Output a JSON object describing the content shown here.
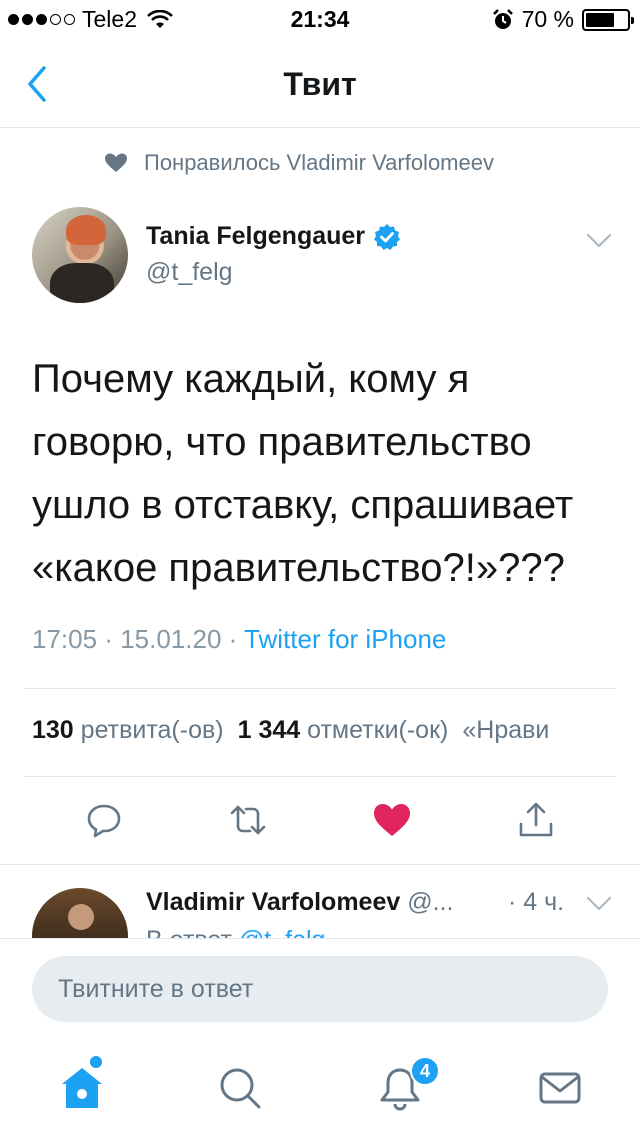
{
  "status_bar": {
    "carrier": "Tele2",
    "time": "21:34",
    "battery_text": "70 %",
    "battery_level": 0.7,
    "signal_bars_filled": 3,
    "signal_bars_total": 5
  },
  "nav": {
    "title": "Твит"
  },
  "tweet": {
    "liked_by": "Понравилось Vladimir Varfolomeev",
    "author_name": "Tania Felgengauer",
    "author_handle": "@t_felg",
    "text": "Почему каждый, кому я говорю, что правительство ушло в отставку, спрашивает «какое правительство?!»???",
    "time": "17:05",
    "date": "15.01.20",
    "source": "Twitter for iPhone",
    "retweets_count": "130",
    "retweets_label": "ретвита(-ов)",
    "likes_count": "1 344",
    "likes_label": "отметки(-ок)",
    "likes_more": "«Нрави"
  },
  "reply": {
    "name": "Vladimir Varfolomeev",
    "handle": "@...",
    "time": "· 4 ч.",
    "reply_prefix": "В ответ",
    "reply_mention": "@t_felg"
  },
  "compose": {
    "placeholder": "Твитните в ответ"
  },
  "tab_bar": {
    "notifications_badge": "4"
  },
  "colors": {
    "accent": "#1da1f2",
    "like": "#e0245e",
    "secondary_text": "#657786",
    "divider": "#e1e8ed"
  }
}
